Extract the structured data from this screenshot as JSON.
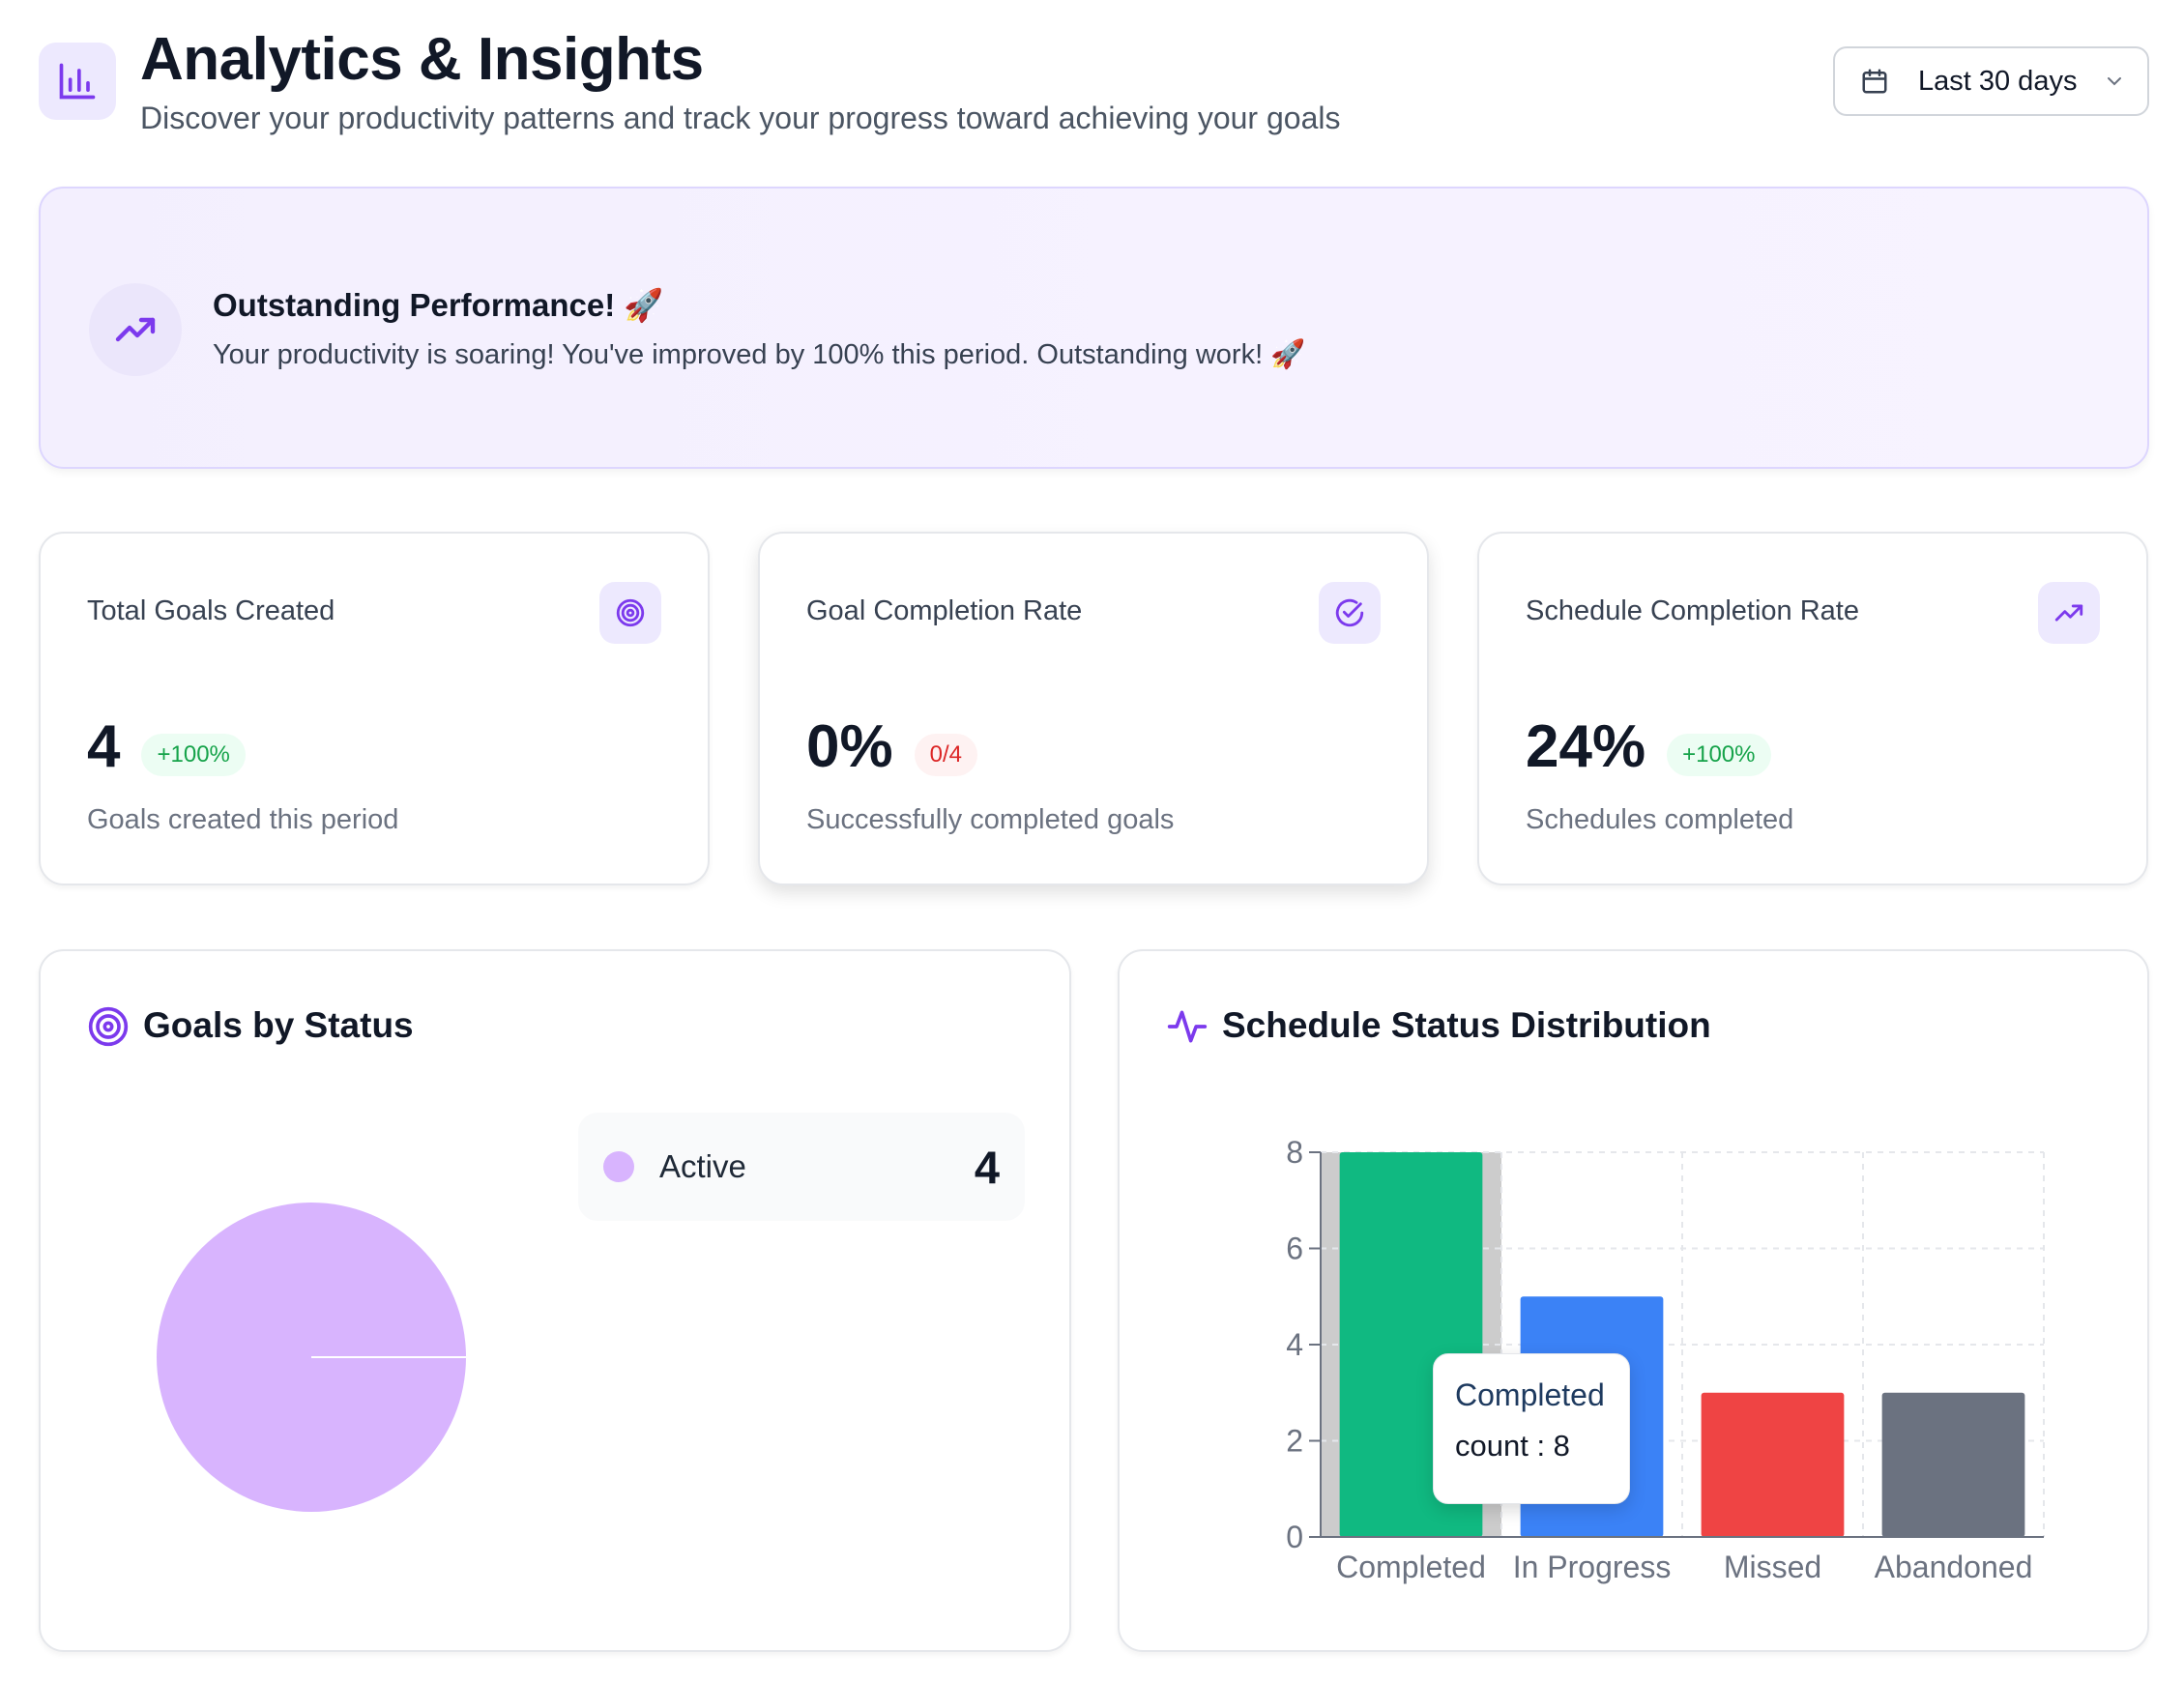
{
  "header": {
    "title": "Analytics & Insights",
    "subtitle": "Discover your productivity patterns and track your progress toward achieving your goals",
    "date_range": "Last 30 days"
  },
  "banner": {
    "title": "Outstanding Performance! 🚀",
    "text": "Your productivity is soaring! You've improved by 100% this period. Outstanding work! 🚀"
  },
  "stats": [
    {
      "title": "Total Goals Created",
      "value": "4",
      "badge": "+100%",
      "badge_kind": "positive",
      "sub": "Goals created this period",
      "icon": "target-icon"
    },
    {
      "title": "Goal Completion Rate",
      "value": "0%",
      "badge": "0/4",
      "badge_kind": "negative",
      "sub": "Successfully completed goals",
      "icon": "check-circle-icon"
    },
    {
      "title": "Schedule Completion Rate",
      "value": "24%",
      "badge": "+100%",
      "badge_kind": "positive",
      "sub": "Schedules completed",
      "icon": "trending-up-icon"
    }
  ],
  "goals_panel": {
    "title": "Goals by Status",
    "legend": [
      {
        "label": "Active",
        "value": "4",
        "color": "#d8b4fe"
      }
    ]
  },
  "schedule_panel": {
    "title": "Schedule Status Distribution",
    "tooltip": {
      "name": "Completed",
      "text": "count : 8"
    }
  },
  "colors": {
    "accent": "#7c3aed",
    "positive": "#16a34a",
    "negative": "#dc2626"
  },
  "chart_data": [
    {
      "type": "pie",
      "title": "Goals by Status",
      "categories": [
        "Active"
      ],
      "values": [
        4
      ],
      "colors": [
        "#d8b4fe"
      ],
      "legend": "right"
    },
    {
      "type": "bar",
      "title": "Schedule Status Distribution",
      "categories": [
        "Completed",
        "In Progress",
        "Missed",
        "Abandoned"
      ],
      "values": [
        8,
        5,
        3,
        3
      ],
      "colors": [
        "#10b981",
        "#3b82f6",
        "#ef4444",
        "#6b7280"
      ],
      "yticks": [
        0,
        2,
        4,
        6,
        8
      ],
      "ylim": [
        0,
        8
      ],
      "grid": true,
      "xlabel": "",
      "ylabel": "",
      "highlighted": "Completed"
    }
  ]
}
